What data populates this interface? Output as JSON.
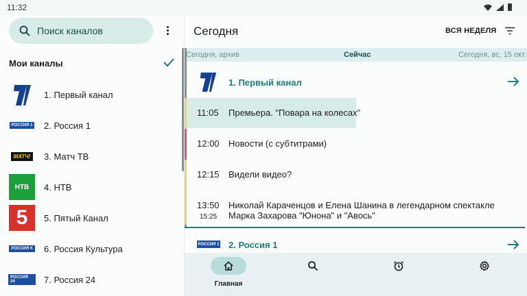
{
  "status": {
    "time": "11:32"
  },
  "left": {
    "search_placeholder": "Поиск каналов",
    "section_title": "Мои каналы",
    "channels": [
      {
        "name": "1. Первый канал",
        "logo": "first-channel-logo"
      },
      {
        "name": "2. Россия 1",
        "logo": "russia1-logo",
        "logo_text": "РОССИЯ 1"
      },
      {
        "name": "3. Матч ТВ",
        "logo": "match-tv-logo",
        "logo_text": "МАТЧ!"
      },
      {
        "name": "4. НТВ",
        "logo": "ntv-logo",
        "logo_text": "НТВ"
      },
      {
        "name": "5. Пятый Канал",
        "logo": "channel5-logo",
        "logo_text": "5"
      },
      {
        "name": "6. Россия Культура",
        "logo": "russia-k-logo",
        "logo_text": "РОССИЯ К"
      },
      {
        "name": "7. Россия 24",
        "logo": "russia24-logo",
        "logo_text": "РОССИЯ 24"
      }
    ]
  },
  "right": {
    "title": "Сегодня",
    "week_button": "ВСЯ НЕДЕЛЯ",
    "timeline": {
      "archive": "Сегодня, архив",
      "now": "Сейчас",
      "date": "Сегодня, вс, 15 окт."
    },
    "channel1": {
      "name": "1. Первый канал"
    },
    "programs": [
      {
        "time": "11:05",
        "title": "Премьера. \"Повара на колесах\"",
        "bar_color": "#e8d46a"
      },
      {
        "time": "12:00",
        "title": "Новости (с субтитрами)",
        "bar_color": "#d9547a"
      },
      {
        "time": "12:15",
        "title": "Видели видео?",
        "bar_color": "#e8d46a"
      },
      {
        "time": "13:50",
        "time2": "15:25",
        "title": "Николай Караченцов и Елена Шанина в легендарном спектакле Марка Захарова \"Юнона\" и \"Авось\"",
        "bar_color": "#e8d46a"
      }
    ],
    "channel2": {
      "name": "2. Россия 1",
      "logo_text": "РОССИЯ 1"
    }
  },
  "nav": {
    "home": "Главная",
    "items": [
      "home-icon",
      "search-icon",
      "alarm-icon",
      "settings-icon"
    ]
  },
  "colors": {
    "accent": "#1f7d78",
    "highlight": "#d5ece9"
  }
}
